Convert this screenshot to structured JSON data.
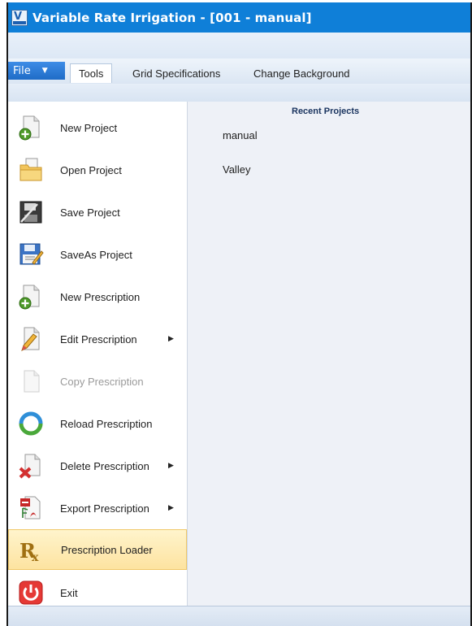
{
  "window": {
    "title": "Variable Rate Irrigation - [001 - manual]",
    "title_bar_color": "#0f7fd8"
  },
  "ribbon": {
    "file_label": "File",
    "tabs": [
      {
        "label": "Tools",
        "active": true
      },
      {
        "label": "Grid Specifications",
        "active": false
      },
      {
        "label": "Change Background",
        "active": false
      }
    ]
  },
  "menu": {
    "items": [
      {
        "label": "New Project",
        "icon": "new-document-plus-icon",
        "enabled": true,
        "has_submenu": false
      },
      {
        "label": "Open Project",
        "icon": "open-folder-icon",
        "enabled": true,
        "has_submenu": false
      },
      {
        "label": "Save Project",
        "icon": "floppy-disk-icon",
        "enabled": true,
        "has_submenu": false
      },
      {
        "label": "SaveAs Project",
        "icon": "floppy-disk-edit-icon",
        "enabled": true,
        "has_submenu": false
      },
      {
        "label": "New Prescription",
        "icon": "new-document-plus-icon",
        "enabled": true,
        "has_submenu": false
      },
      {
        "label": "Edit Prescription",
        "icon": "document-pencil-icon",
        "enabled": true,
        "has_submenu": true
      },
      {
        "label": "Copy Prescription",
        "icon": "document-copy-icon",
        "enabled": false,
        "has_submenu": false
      },
      {
        "label": "Reload Prescription",
        "icon": "reload-arrows-icon",
        "enabled": true,
        "has_submenu": false
      },
      {
        "label": "Delete Prescription",
        "icon": "document-delete-icon",
        "enabled": true,
        "has_submenu": true
      },
      {
        "label": "Export Prescription",
        "icon": "pdf-export-icon",
        "enabled": true,
        "has_submenu": true
      },
      {
        "label": "Prescription Loader",
        "icon": "rx-icon",
        "enabled": true,
        "has_submenu": false,
        "highlighted": true
      },
      {
        "label": "Exit",
        "icon": "power-icon",
        "enabled": true,
        "has_submenu": false
      }
    ]
  },
  "recent": {
    "heading": "Recent Projects",
    "items": [
      "manual",
      "Valley"
    ]
  }
}
